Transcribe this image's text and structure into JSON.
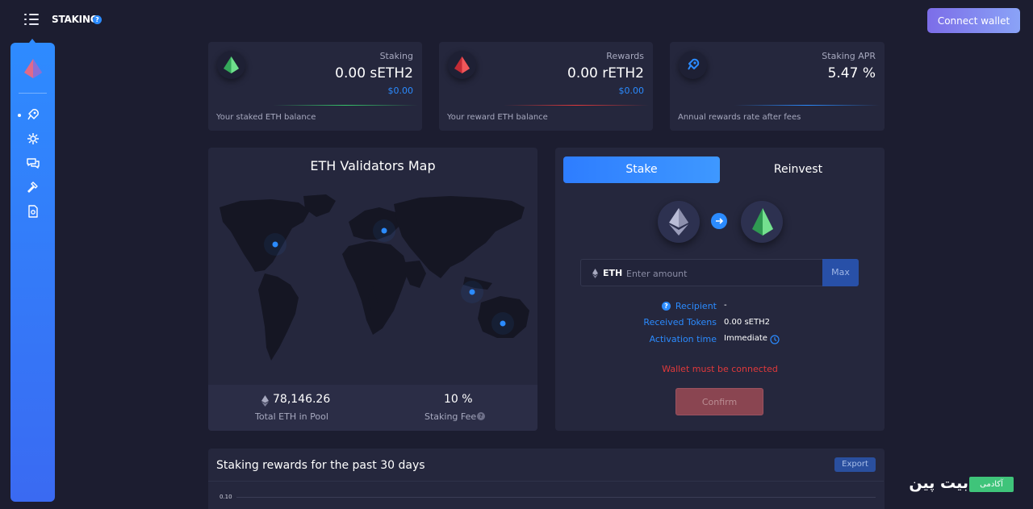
{
  "header": {
    "page_title": "STAKING",
    "help_glyph": "?",
    "connect_label": "Connect wallet"
  },
  "sidebar": {
    "items": [
      "rocket-icon",
      "validators-icon",
      "chat-icon",
      "governance-icon",
      "docs-icon"
    ]
  },
  "stats": [
    {
      "label": "Staking",
      "value": "0.00 sETH2",
      "usd": "$0.00",
      "desc": "Your staked ETH balance",
      "icon": "green-gem",
      "accent": "#37c46a"
    },
    {
      "label": "Rewards",
      "value": "0.00 rETH2",
      "usd": "$0.00",
      "desc": "Your reward ETH balance",
      "icon": "red-gem",
      "accent": "#e0393b"
    },
    {
      "label": "Staking APR",
      "value": "5.47 %",
      "usd": "",
      "desc": "Annual rewards rate after fees",
      "icon": "rocket-icon",
      "accent": "#2b8bff"
    }
  ],
  "map": {
    "title": "ETH Validators Map",
    "total_value": "78,146.26",
    "total_label": "Total ETH in Pool",
    "fee_value": "10 %",
    "fee_label": "Staking Fee"
  },
  "stake": {
    "tabs": [
      "Stake",
      "Reinvest"
    ],
    "currency": "ETH",
    "amount_placeholder": "Enter amount",
    "max_label": "Max",
    "recipient_label": "Recipient",
    "recipient_value": "-",
    "received_label": "Received Tokens",
    "received_value": "0.00 sETH2",
    "activation_label": "Activation time",
    "activation_value": "Immediate",
    "warning": "Wallet must be connected",
    "confirm_label": "Confirm"
  },
  "rewards_chart": {
    "title": "Staking rewards for the past 30 days",
    "export_label": "Export",
    "y_tick": "0.10"
  },
  "watermark": {
    "brand": "بیت پین",
    "badge": "آکادمی"
  },
  "colors": {
    "accent": "#2b8bff",
    "background": "#1c1d30",
    "card": "#25273d",
    "danger": "#e0393b"
  }
}
